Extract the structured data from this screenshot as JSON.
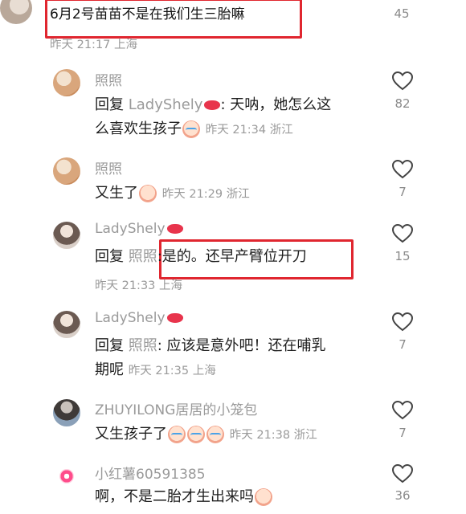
{
  "top_comment": {
    "text": "6月2号苗苗不是在我们生三胎嘛",
    "meta": "昨天 21:17 上海",
    "likes": "45"
  },
  "replies": [
    {
      "name": "照照",
      "prefix": "回复 ",
      "mention": "LadyShely",
      "text_line1": ": 天呐，她怎么这",
      "text_line2": "么喜欢生孩子",
      "meta": "昨天 21:34 浙江",
      "likes": "82",
      "avatar": "orange-avatar"
    },
    {
      "name": "照照",
      "text": "又生了",
      "meta": "昨天 21:29 浙江",
      "likes": "7",
      "avatar": "orange-avatar"
    },
    {
      "name": "LadyShely",
      "prefix": "回复 ",
      "mention": "照照",
      "text": ":是的。还早产臂位开刀",
      "meta": "昨天 21:33 上海",
      "likes": "15",
      "avatar": "girl-avatar"
    },
    {
      "name": "LadyShely",
      "prefix": "回复 ",
      "mention": "照照",
      "text_line1": ": 应该是意外吧！还在哺乳",
      "text_line2": "期呢",
      "meta": "昨天 21:35 上海",
      "likes": "7",
      "avatar": "girl-avatar"
    },
    {
      "name": "ZHUYILONG居居的小笼包",
      "text": "又生孩子了",
      "meta": "昨天 21:38 浙江",
      "likes": "7",
      "avatar": "boy-avatar"
    },
    {
      "name": "小红薯60591385",
      "text": "啊，不是二胎才生出来吗",
      "meta": "",
      "likes": "36",
      "avatar": "default-avatar"
    }
  ],
  "colors": {
    "highlight": "#e0262f",
    "muted": "#9a9a9a",
    "text": "#1e1e1e"
  },
  "icons": [
    "heart-icon",
    "lips-icon",
    "emoji-face-icon",
    "crying-face-icon"
  ]
}
